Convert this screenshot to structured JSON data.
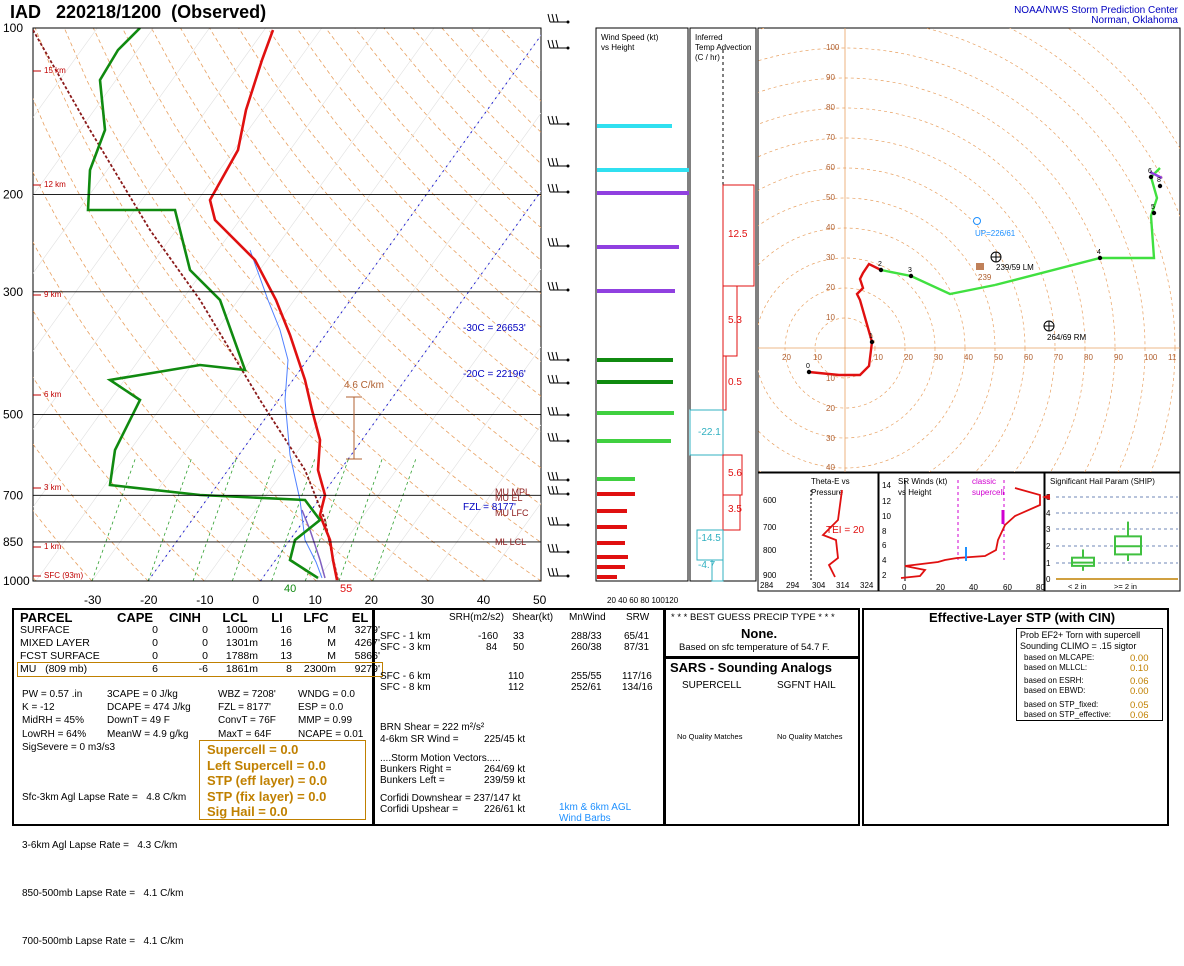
{
  "header": {
    "title": "IAD   220218/1200  (Observed)",
    "credit_line1": "NOAA/NWS Storm Prediction Center",
    "credit_line2": "Norman, Oklahoma"
  },
  "skewt": {
    "pressure_ticks": [
      "100",
      "200",
      "300",
      "500",
      "700",
      "850",
      "1000"
    ],
    "temp_ticks": [
      "-30",
      "-20",
      "-10",
      "0",
      "10",
      "20",
      "30",
      "40",
      "50"
    ],
    "height_labels": [
      "15 km",
      "12 km",
      "9 km",
      "6 km",
      "3 km",
      "1 km",
      "SFC (93m)"
    ],
    "annotations": {
      "lapse": "4.6 C/km",
      "m30c": "-30C = 26653'",
      "m20c": "-20C = 22196'",
      "fzl": "FZL = 8177'",
      "mu_mpl": "MU  MPL",
      "mu_el": "MU  EL",
      "mu_lfc": "MU  LFC",
      "ml_lcl": "ML  LCL",
      "sfc_t": "55",
      "sfc_td": "40"
    }
  },
  "wind_speed_panel": {
    "title1": "Wind Speed (kt)",
    "title2": "vs Height",
    "ticks": "20 40 60 80 100120"
  },
  "temp_adv_panel": {
    "title1": "Inferred",
    "title2": "Temp Advection",
    "title3": "(C / hr)",
    "values": [
      "12.5",
      "5.3",
      "0.5",
      "-22.1",
      "5.6",
      "3.5",
      "-14.5",
      "-4.7"
    ]
  },
  "hodograph": {
    "ring_labels": [
      "100",
      "90",
      "80",
      "70",
      "60",
      "50",
      "40",
      "30",
      "20",
      "10",
      "10",
      "20",
      "30",
      "40"
    ],
    "up_label": "UP=226/61",
    "lm_label": "239/59 LM",
    "rm_label": "264/69 RM",
    "mean_label": "239",
    "x_labels": [
      "20",
      "10",
      "10",
      "20",
      "30",
      "40",
      "50",
      "60",
      "70",
      "80",
      "90",
      "100",
      "11"
    ],
    "point_labels": [
      "0",
      "1",
      "2",
      "3",
      "4",
      "5",
      "6",
      "8"
    ]
  },
  "theta_panel": {
    "title1": "Theta-E vs",
    "title2": "Pressure",
    "tei": "TEI = 20",
    "y_ticks": [
      "600",
      "700",
      "800",
      "900"
    ],
    "x_ticks": [
      "284",
      "294",
      "304",
      "314",
      "324"
    ]
  },
  "sr_winds": {
    "title1": "SR Winds (kt)",
    "title2": "vs Height",
    "classic1": "classic",
    "classic2": "supercell",
    "y_ticks": [
      "14",
      "12",
      "10",
      "8",
      "6",
      "4",
      "2"
    ],
    "x_ticks": [
      "0",
      "20",
      "40",
      "60",
      "80"
    ]
  },
  "ship": {
    "title": "Significant Hail Param (SHIP)",
    "y_ticks": [
      "5",
      "4",
      "3",
      "2",
      "1",
      "0"
    ],
    "lt2": "< 2 in",
    "ge2": ">= 2 in"
  },
  "parcel_table": {
    "headers": [
      "PARCEL",
      "CAPE",
      "CINH",
      "LCL",
      "LI",
      "LFC",
      "EL"
    ],
    "rows": [
      [
        "SURFACE",
        "0",
        "0",
        "1000m",
        "16",
        "M",
        "3279'"
      ],
      [
        "MIXED LAYER",
        "0",
        "0",
        "1301m",
        "16",
        "M",
        "4267'"
      ],
      [
        "FCST SURFACE",
        "0",
        "0",
        "1788m",
        "13",
        "M",
        "5866'"
      ],
      [
        "MU   (809 mb)",
        "6",
        "-6",
        "1861m",
        "8",
        "2300m",
        "9279'"
      ]
    ]
  },
  "indices": {
    "col1": [
      "PW = 0.57 .in",
      "K = -12",
      "MidRH = 45%",
      "LowRH = 64%",
      "SigSevere = 0 m3/s3"
    ],
    "col2": [
      "3CAPE = 0 J/kg",
      "DCAPE = 474 J/kg",
      "DownT = 49 F",
      "MeanW = 4.9 g/kg"
    ],
    "col3": [
      "WBZ = 7208'",
      "FZL = 8177'",
      "ConvT = 76F",
      "MaxT = 64F"
    ],
    "col4": [
      "WNDG = 0.0",
      "ESP = 0.0",
      "MMP = 0.99",
      "NCAPE = 0.01"
    ],
    "lapse": [
      "Sfc-3km Agl Lapse Rate =   4.8 C/km",
      "3-6km Agl Lapse Rate =   4.3 C/km",
      "850-500mb Lapse Rate =   4.1 C/km",
      "700-500mb Lapse Rate =   4.1 C/km"
    ],
    "composite": [
      "Supercell = 0.0",
      "Left Supercell = 0.0",
      "STP (eff layer) = 0.0",
      "STP (fix layer) = 0.0",
      "Sig Hail = 0.0"
    ]
  },
  "kinematics": {
    "headers": [
      "SRH(m2/s2)",
      "Shear(kt)",
      "MnWind",
      "SRW"
    ],
    "rows": [
      [
        "SFC - 1 km",
        "-160",
        "33",
        "288/33",
        "65/41"
      ],
      [
        "SFC - 3 km",
        "84",
        "50",
        "260/38",
        "87/31"
      ],
      [
        "SFC - 6 km",
        "",
        "110",
        "255/55",
        "117/16"
      ],
      [
        "SFC - 8 km",
        "",
        "112",
        "252/61",
        "134/16"
      ]
    ],
    "brn": "BRN Shear =  222 m²/s²",
    "srwind": "4-6km SR Wind =",
    "srwind_val": "225/45 kt",
    "smv_title": "....Storm Motion Vectors.....",
    "bunkers_right": "Bunkers Right =",
    "bunkers_right_val": "264/69 kt",
    "bunkers_left": "Bunkers Left =",
    "bunkers_left_val": "239/59 kt",
    "corfidi_down": "Corfidi Downshear = 237/147 kt",
    "corfidi_up": "Corfidi Upshear =",
    "corfidi_up_val": "226/61 kt",
    "barb_label1": "1km & 6km AGL",
    "barb_label2": "Wind Barbs"
  },
  "precip": {
    "title": "* * * BEST GUESS PRECIP TYPE * * *",
    "value": "None.",
    "note": "Based on sfc temperature of 54.7 F."
  },
  "sars": {
    "title": "SARS - Sounding Analogs",
    "col1": "SUPERCELL",
    "col2": "SGFNT HAIL",
    "none1": "No Quality Matches",
    "none2": "No Quality Matches"
  },
  "stp": {
    "title": "Effective-Layer STP (with CIN)",
    "box_title1": "Prob EF2+ Torn with supercell",
    "box_title2": "Sounding CLIMO = .15 sigtor",
    "rows": [
      [
        "based on MLCAPE:",
        "0.00"
      ],
      [
        "based on MLLCL:",
        "0.10"
      ],
      [
        "based on ESRH:",
        "0.06"
      ],
      [
        "based on EBWD:",
        "0.00"
      ],
      [
        "based on STP_fixed:",
        "0.05"
      ],
      [
        "based on STP_effective:",
        "0.06"
      ]
    ],
    "y_ticks": [
      "11",
      "10",
      "9",
      "8",
      "7",
      "6",
      "5",
      "4",
      "3",
      "2",
      "1",
      "0"
    ],
    "categories": [
      "EF4+",
      "EF3",
      "EF2",
      "EF1",
      "EF0",
      "NONTOR"
    ]
  },
  "chart_data": {
    "type": "skew-t sounding",
    "title": "IAD   220218/1200  (Observed)",
    "temperature_profile": {
      "pressure_mb": [
        1000,
        950,
        925,
        900,
        850,
        800,
        750,
        700,
        650,
        600,
        550,
        500,
        450,
        400,
        350,
        300,
        250,
        200,
        150,
        100
      ],
      "temp_c": [
        12.8,
        11,
        10.5,
        9,
        7,
        5.5,
        3,
        1,
        0,
        -4,
        -7,
        -12,
        -19,
        -25,
        -31,
        -39,
        -49,
        -58,
        -58,
        -60
      ]
    },
    "dewpoint_profile": {
      "pressure_mb": [
        1000,
        950,
        925,
        900,
        850,
        800,
        750,
        700,
        650,
        600,
        550,
        500,
        450,
        400,
        350,
        300,
        250,
        200,
        150,
        100
      ],
      "dewpoint_c": [
        4.4,
        2,
        0,
        1,
        -1,
        -3,
        -8,
        -30,
        -34,
        -38,
        -40,
        -45,
        -48,
        -40,
        -50,
        -60,
        -65,
        -72,
        -70,
        -68
      ]
    },
    "hodograph_series": [
      {
        "points": [
          [
            -12,
            -8
          ],
          [
            -2,
            -9
          ],
          [
            5,
            -9
          ],
          [
            8,
            -6
          ],
          [
            9,
            2
          ],
          [
            5,
            16
          ],
          [
            4,
            18
          ],
          [
            6,
            20
          ],
          [
            5,
            23
          ],
          [
            6,
            25
          ],
          [
            8,
            28
          ],
          [
            12,
            26
          ],
          [
            22,
            24
          ],
          [
            35,
            18
          ],
          [
            50,
            21
          ],
          [
            85,
            30
          ],
          [
            103,
            30
          ],
          [
            102,
            44
          ],
          [
            104,
            50
          ],
          [
            102,
            57
          ],
          [
            105,
            60
          ]
        ]
      }
    ],
    "wind_speed_kt": {
      "heights_km": [
        14.5,
        13.5,
        12.5,
        11,
        10,
        7,
        6.5,
        5.5,
        4.5,
        3,
        2.5,
        2,
        1.5,
        1,
        0.5
      ],
      "speed_kt": [
        105,
        105,
        110,
        110,
        108,
        55,
        65,
        50,
        55,
        20,
        22,
        20,
        25,
        18,
        14
      ]
    },
    "temp_advection_c_hr": [
      12.5,
      5.3,
      0.5,
      -22.1,
      5.6,
      3.5,
      -14.5,
      -4.7
    ],
    "stp_boxes": [
      {
        "category": "EF4+",
        "p10": 1.2,
        "p25": 2.8,
        "median": 5.4,
        "p75": 8.4,
        "p90": 11.5
      },
      {
        "category": "EF3",
        "p10": 0.4,
        "p25": 1.2,
        "median": 2.4,
        "p75": 4.5,
        "p90": 9.1
      },
      {
        "category": "EF2",
        "p10": 0.2,
        "p25": 0.7,
        "median": 1.7,
        "p75": 3.5,
        "p90": 6.7
      },
      {
        "category": "EF1",
        "p10": 0,
        "p25": 0.3,
        "median": 1.2,
        "p75": 2.6,
        "p90": 4.6
      },
      {
        "category": "EF0",
        "p10": 0,
        "p25": 0.1,
        "median": 0.8,
        "p75": 2.0,
        "p90": 3.7
      },
      {
        "category": "NONTOR",
        "p10": 0,
        "p25": 0,
        "median": 0.2,
        "p75": 0.6,
        "p90": 1.1
      }
    ],
    "ship_boxes": [
      {
        "category": "< 2 in",
        "p10": 0.5,
        "p25": 0.8,
        "median": 1.0,
        "p75": 1.3,
        "p90": 1.8
      },
      {
        "category": ">= 2 in",
        "p10": 1.1,
        "p25": 1.5,
        "median": 2.0,
        "p75": 2.6,
        "p90": 3.5
      }
    ]
  }
}
